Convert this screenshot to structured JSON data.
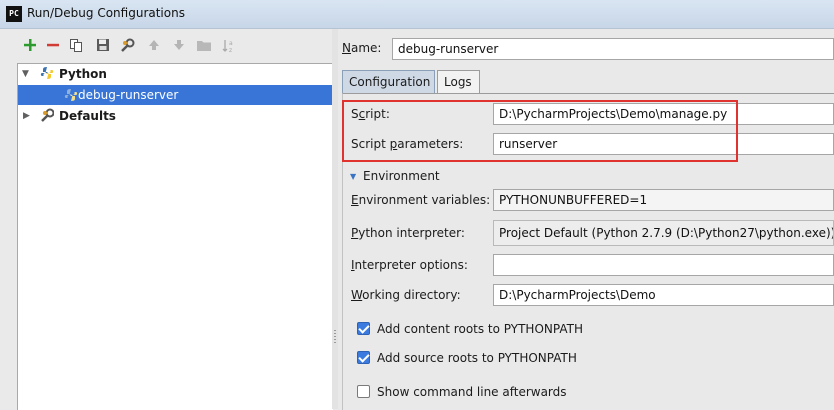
{
  "window": {
    "icon_text": "PC",
    "title": "Run/Debug Configurations"
  },
  "toolbar": {
    "add_icon": "plus-icon",
    "remove_icon": "minus-icon",
    "copy_icon": "copy-icon",
    "save_icon": "save-icon",
    "edit_defaults_icon": "wrench-icon",
    "move_up_icon": "arrow-up-icon",
    "move_down_icon": "arrow-down-icon",
    "folder_icon": "folder-icon",
    "sort_icon": "sort-icon"
  },
  "tree": {
    "python_label": "Python",
    "config_label": "debug-runserver",
    "defaults_label": "Defaults"
  },
  "form": {
    "name_label_u": "N",
    "name_label_rest": "ame:",
    "name_value": "debug-runserver",
    "tabs": [
      "Configuration",
      "Logs"
    ],
    "script_label_pre": "S",
    "script_label_u": "c",
    "script_label_rest": "ript:",
    "script_value": "D:\\PycharmProjects\\Demo\\manage.py",
    "params_label_pre": "Script ",
    "params_label_u": "p",
    "params_label_rest": "arameters:",
    "params_value": "runserver",
    "environment_label": "Environment",
    "env_vars_label_pre": "",
    "env_vars_label_u": "E",
    "env_vars_label_rest": "nvironment variables:",
    "env_vars_value": "PYTHONUNBUFFERED=1",
    "interpreter_label_u": "P",
    "interpreter_label_rest": "ython interpreter:",
    "interpreter_value": "Project Default (Python 2.7.9 (D:\\Python27\\python.exe))",
    "interp_options_label_u": "I",
    "interp_options_label_rest": "nterpreter options:",
    "interp_options_value": "",
    "workdir_label_u": "W",
    "workdir_label_rest": "orking directory:",
    "workdir_value": "D:\\PycharmProjects\\Demo",
    "add_content_roots_label": "Add content roots to PYTHONPATH",
    "add_content_roots_checked": true,
    "add_source_roots_label": "Add source roots to PYTHONPATH",
    "add_source_roots_checked": true,
    "show_cmdline_label": "Show command line afterwards",
    "show_cmdline_checked": false
  },
  "colors": {
    "selection": "#3875d7",
    "highlight_border": "#e0322f",
    "checkbox_checked": "#3b7be0"
  }
}
